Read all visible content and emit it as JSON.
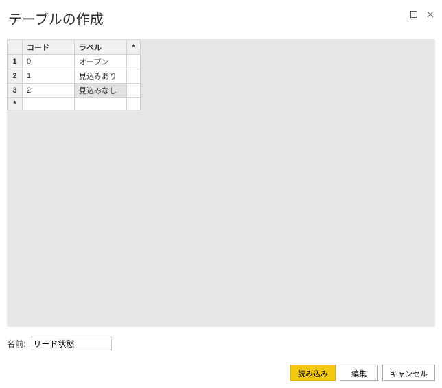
{
  "dialog": {
    "title": "テーブルの作成"
  },
  "table": {
    "headers": {
      "code": "コード",
      "label": "ラベル",
      "star": "*"
    },
    "rows": [
      {
        "n": "1",
        "code": "0",
        "label": "オープン"
      },
      {
        "n": "2",
        "code": "1",
        "label": "見込みあり"
      },
      {
        "n": "3",
        "code": "2",
        "label": "見込みなし"
      }
    ],
    "new_row_marker": "*"
  },
  "name_field": {
    "label": "名前:",
    "value": "リード状態"
  },
  "buttons": {
    "load": "読み込み",
    "edit": "編集",
    "cancel": "キャンセル"
  }
}
